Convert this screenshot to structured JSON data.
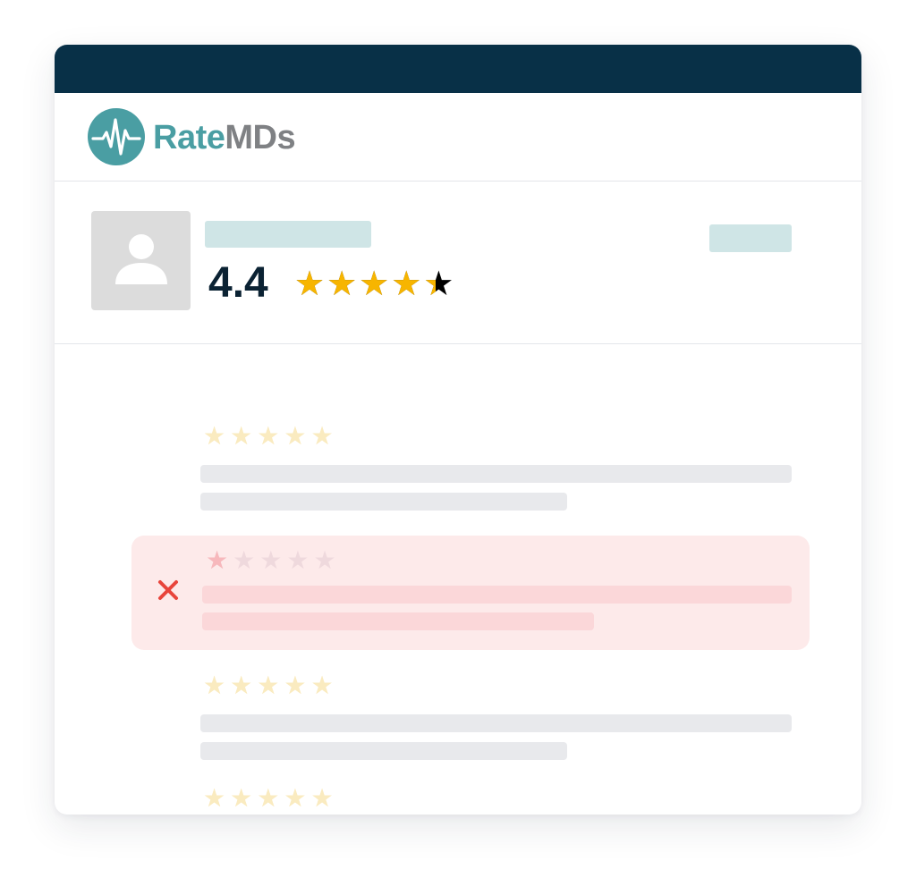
{
  "brand": {
    "name_part1": "Rate",
    "name_part2": "MDs",
    "logo_icon": "heartbeat-circle-icon",
    "colors": {
      "teal": "#4a9ea3",
      "gray": "#7f8184",
      "topbar": "#083047"
    }
  },
  "profile": {
    "avatar_icon": "user-silhouette-icon",
    "rating_text": "4.4",
    "rating_value": 4.4,
    "rating_max": 5,
    "star_color": "#f7b500"
  },
  "reviews": [
    {
      "status": "accepted",
      "stars": 5,
      "max": 5
    },
    {
      "status": "rejected",
      "stars": 1,
      "max": 5,
      "status_icon": "red-x-icon",
      "status_color": "#e8453c"
    },
    {
      "status": "accepted",
      "stars": 5,
      "max": 5
    },
    {
      "status": "accepted",
      "stars": 5,
      "max": 5
    }
  ]
}
